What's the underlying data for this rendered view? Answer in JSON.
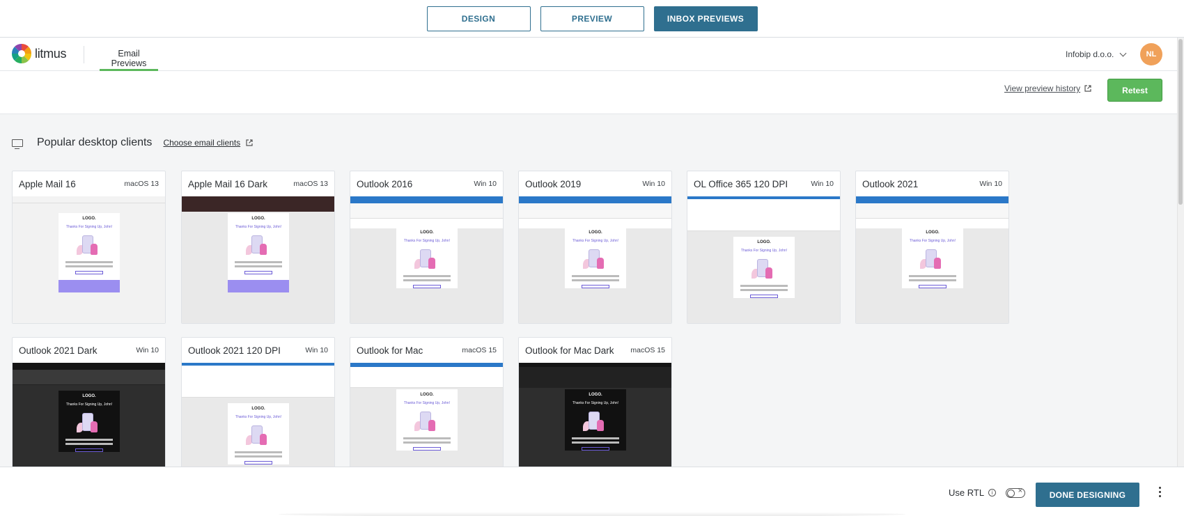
{
  "top_tabs": [
    {
      "label": "DESIGN",
      "active": false
    },
    {
      "label": "PREVIEW",
      "active": false
    },
    {
      "label": "INBOX PREVIEWS",
      "active": true
    }
  ],
  "header": {
    "brand": "litmus",
    "nav_tab": "Email Previews",
    "org": "Infobip d.o.o.",
    "avatar_initials": "NL"
  },
  "actions": {
    "history_link": "View preview history",
    "retest_label": "Retest"
  },
  "section": {
    "icon": "monitor-icon",
    "title": "Popular desktop clients",
    "choose_link": "Choose email clients"
  },
  "email": {
    "logo": "LOGO.",
    "headline": "Thanks For Signing Up, John!"
  },
  "clients": [
    {
      "name": "Apple Mail 16",
      "os": "macOS 13",
      "theme": "light"
    },
    {
      "name": "Apple Mail 16 Dark",
      "os": "macOS 13",
      "theme": "dark-apple"
    },
    {
      "name": "Outlook 2016",
      "os": "Win 10",
      "theme": "outlook"
    },
    {
      "name": "Outlook 2019",
      "os": "Win 10",
      "theme": "outlook"
    },
    {
      "name": "OL Office 365 120 DPI",
      "os": "Win 10",
      "theme": "office"
    },
    {
      "name": "Outlook 2021",
      "os": "Win 10",
      "theme": "outlook"
    },
    {
      "name": "Outlook 2021 Dark",
      "os": "Win 10",
      "theme": "dark"
    },
    {
      "name": "Outlook 2021 120 DPI",
      "os": "Win 10",
      "theme": "office"
    },
    {
      "name": "Outlook for Mac",
      "os": "macOS 15",
      "theme": "mac"
    },
    {
      "name": "Outlook for Mac Dark",
      "os": "macOS 15",
      "theme": "mac-dark"
    }
  ],
  "footer": {
    "rtl_label": "Use RTL",
    "rtl_enabled": false,
    "done_label": "DONE DESIGNING"
  },
  "colors": {
    "primary": "#2f6f8f",
    "success": "#5cb85c",
    "avatar": "#f0a15a",
    "email_accent": "#6b5bd6"
  }
}
